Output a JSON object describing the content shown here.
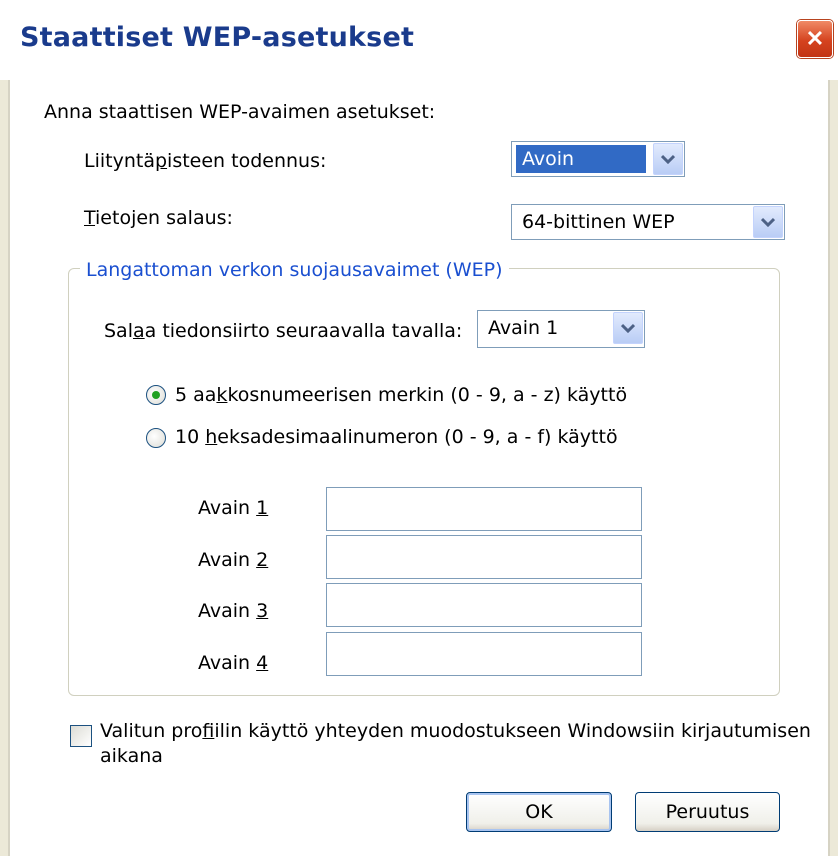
{
  "window": {
    "title": "Staattiset WEP-asetukset",
    "close_glyph": "✕"
  },
  "intro_label": "Anna staattisen WEP-avaimen asetukset:",
  "auth": {
    "label_pre": "Liityntä",
    "label_u": "p",
    "label_post": "isteen todennus:",
    "value": "Avoin"
  },
  "encryption": {
    "label_u": "T",
    "label_post": "ietojen salaus:",
    "value": "64-bittinen WEP"
  },
  "keys_group": {
    "title": "Langattoman verkon suojausavaimet (WEP)",
    "encrypt_label_pre": "Sal",
    "encrypt_label_u": "a",
    "encrypt_label_post": "a tiedonsiirto seuraavalla tavalla:",
    "encrypt_key_value": "Avain 1",
    "radio_ascii": {
      "pre": "5 aa",
      "u": "k",
      "post": "kosnumeerisen  merkin (0 - 9, a - z) käyttö",
      "checked": true
    },
    "radio_hex": {
      "pre": "10 ",
      "u": "h",
      "post": "eksadesimaalinumeron (0 - 9, a - f) käyttö",
      "checked": false
    },
    "keys": [
      {
        "label": "Avain ",
        "num": "1",
        "value": ""
      },
      {
        "label": "Avain ",
        "num": "2",
        "value": ""
      },
      {
        "label": "Avain ",
        "num": "3",
        "value": ""
      },
      {
        "label": "Avain ",
        "num": "4",
        "value": ""
      }
    ]
  },
  "profile_checkbox": {
    "line1_pre": "Valitun pro",
    "line1_u": "f",
    "line1_post": "iilin käyttö yhteyden muodostukseen Windowsiin kirjautumisen",
    "line2": "aikana",
    "checked": false
  },
  "buttons": {
    "ok": "OK",
    "cancel": "Peruutus"
  },
  "icons": {
    "close": "close-icon",
    "dropdown": "chevron-down-icon"
  },
  "colors": {
    "title_text": "#1a3b8c",
    "group_title": "#1a4fd0",
    "selection": "#316ac5",
    "close_button": "#d5431f",
    "radio_dot": "#21a121"
  }
}
